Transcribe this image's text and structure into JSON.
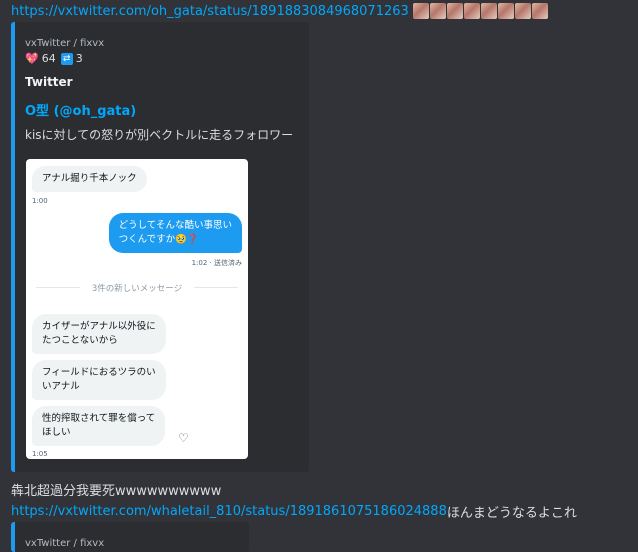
{
  "message1": {
    "link": "https://vxtwitter.com/oh_gata/status/1891883084968071263",
    "emoji_count": 8
  },
  "embed1": {
    "provider": "vxTwitter / fixvx",
    "likes_icon": "heart-icon",
    "likes": "64",
    "retweets_icon": "retweet-icon",
    "retweets": "3",
    "site": "Twitter",
    "author": "O型 (@oh_gata)",
    "description": "kisに対しての怒りが別ベクトルに走るフォロワー",
    "screenshot": {
      "msg1": "アナル掘り千本ノック",
      "ts1": "1:00",
      "msg2_line1": "どうしてそんな酷い事思い",
      "msg2_line2": "つくんですか🥹❓",
      "ts2": "1:02 · 送信済み",
      "divider": "3件の新しいメッセージ",
      "msg3_line1": "カイザーがアナル以外役に",
      "msg3_line2": "たつことないから",
      "msg4_line1": "フィールドにおるツラのい",
      "msg4_line2": "いアナル",
      "msg5_line1": "性的搾取されて罪を償って",
      "msg5_line2": "ほしい",
      "ts3": "1:05"
    }
  },
  "message2": {
    "text": "犇北超過分我要死wwwwwwwwww"
  },
  "message3": {
    "link": "https://vxtwitter.com/whaletail_810/status/1891861075186024888",
    "text": " ほんまどうなるよこれ"
  },
  "embed2": {
    "provider": "vxTwitter / fixvx"
  },
  "colors": {
    "background": "#313338",
    "embed_bg": "#2b2d31",
    "link": "#00a8fc",
    "twitter_blue": "#1d9bf0"
  }
}
